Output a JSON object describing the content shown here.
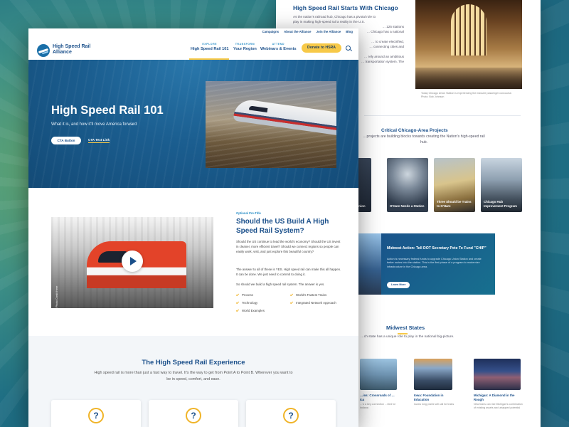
{
  "back_page": {
    "chicago": {
      "title": "High Speed Rail Starts With Chicago",
      "lines": [
        "As the nation's railroad hub, Chicago has a pivotal role to",
        "play in making high-speed rail a reality in the U.S.",
        "… 125 stations",
        "… Chicago has a national",
        "… to create electrified,",
        "… connecting cities and",
        "… rely around an ambitious",
        "… transportation system. The"
      ],
      "photo_caption": "Today Chicago Union Station is experiencing the massive passenger concourse. Photo: Bob Johnson"
    },
    "projects": {
      "title": "Critical Chicago-Area Projects",
      "text": "…projects are building blocks towards creating the Nation's high-speed rail hub.",
      "cards": [
        {
          "label": "…'s Union"
        },
        {
          "label": "O'Hare Needs a Station"
        },
        {
          "label": "Three Should be Trains to O'Hare"
        },
        {
          "label": "Chicago Hub Improvement Program"
        }
      ]
    },
    "banner": {
      "title": "Midwest Action: Tell DOT Secretary Pete To Fund \"CHIP\"",
      "text": "Action is necessary federal funds to upgrade Chicago Union Station and create better routes into the station. This is the first phase of a program to modernize infrastructure in the Chicago area.",
      "button": "Learn More"
    },
    "midwest": {
      "title": "Midwest States",
      "text": "…ch state has a unique role to play in the national big-picture.",
      "states": [
        {
          "label": "…ins: Crossroads of …ica",
          "sub": "…'s a key connection …llied for Indiana"
        },
        {
          "label": "Iowa: Foundation in Education",
          "sub": "Iowa's long prairie will call for trains"
        },
        {
          "label": "Michigan: A Diamond in the Rough",
          "sub": "New trains can rise Michigan's combination of existing assets and untapped potential"
        }
      ]
    }
  },
  "header": {
    "utility_links": [
      "Campaigns",
      "About the Alliance",
      "Join the Alliance",
      "Blog"
    ],
    "logo_line1": "High Speed Rail",
    "logo_line2": "Alliance",
    "nav": [
      {
        "eyebrow": "EXPLORE",
        "label": "High Speed Rail 101"
      },
      {
        "eyebrow": "TRANSFORM",
        "label": "Your Region"
      },
      {
        "eyebrow": "ATTEND",
        "label": "Webinars & Events"
      }
    ],
    "donate_label": "Donate to HSRA"
  },
  "hero": {
    "title": "High Speed Rail 101",
    "subtitle": "What it is, and how it'll move America forward",
    "cta_button": "CTA Button",
    "cta_link": "CTA Text Link"
  },
  "video_section": {
    "photo_credit": "Photo Credit Here",
    "eyebrow": "Optional Pre-Title",
    "title": "Should the US Build A High Speed Rail System?",
    "p1": "Should the US continue to lead the world's economy? Should the US invest in cleaner, more efficient travel? Should we connect regions so people can easily work, visit, and just explore this beautiful country?",
    "p2": "The answer to all of these is YES. High speed rail can make this all happen. It can be done. We just need to commit to doing it.",
    "p3": "So should we build a high speed rail system. The answer is yes.",
    "checklist_left": [
      "Process",
      "Technology",
      "World Examples"
    ],
    "checklist_right": [
      "World's Fastest Trains",
      "Integrated Network Approach"
    ]
  },
  "experience": {
    "title": "The High Speed Rail Experience",
    "text": "High speed rail is more than just a fast way to travel. It's the way to get from Point A to Point B. Wherever you want to be in speed, comfort, and ease.",
    "card_icon": "?"
  },
  "colors": {
    "brand_blue": "#1a4f8a",
    "accent_yellow": "#f7c948",
    "hero_blue": "#1b5e90"
  }
}
